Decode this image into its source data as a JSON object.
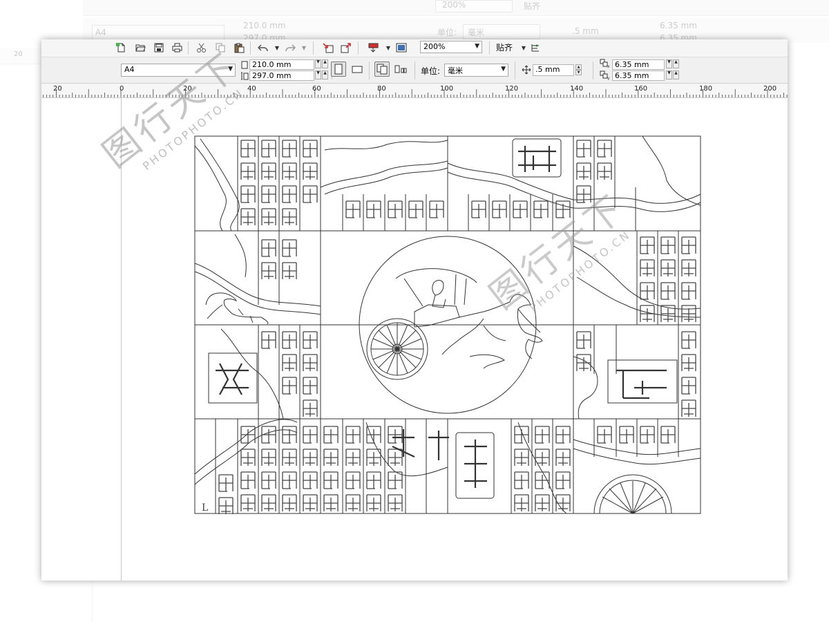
{
  "background": {
    "zoom": "200%",
    "snap": "贴齐",
    "paper_preset": "A4",
    "width": "210.0 mm",
    "height": "297.0 mm",
    "units_label": "单位:",
    "units": "毫米",
    "nudge": ".5 mm",
    "dup_x": "6.35 mm",
    "dup_y": "6.35 mm",
    "ruler_label": "20"
  },
  "toolbar": {
    "zoom": "200%",
    "snap_label": "贴齐",
    "paper_preset": "A4",
    "page_width": "210.0 mm",
    "page_height": "297.0 mm",
    "units_label": "单位:",
    "units_value": "毫米",
    "nudge_distance": ".5 mm",
    "duplicate_x": "6.35 mm",
    "duplicate_y": "6.35 mm"
  },
  "ruler": {
    "labels": [
      "20",
      "0",
      "20",
      "40",
      "60",
      "80",
      "100",
      "120",
      "140",
      "160",
      "180",
      "200"
    ]
  },
  "artwork": {
    "left_mark": "L"
  },
  "watermark": {
    "brand": "图行天下",
    "domain": "PHOTOPHOTO.CN"
  }
}
